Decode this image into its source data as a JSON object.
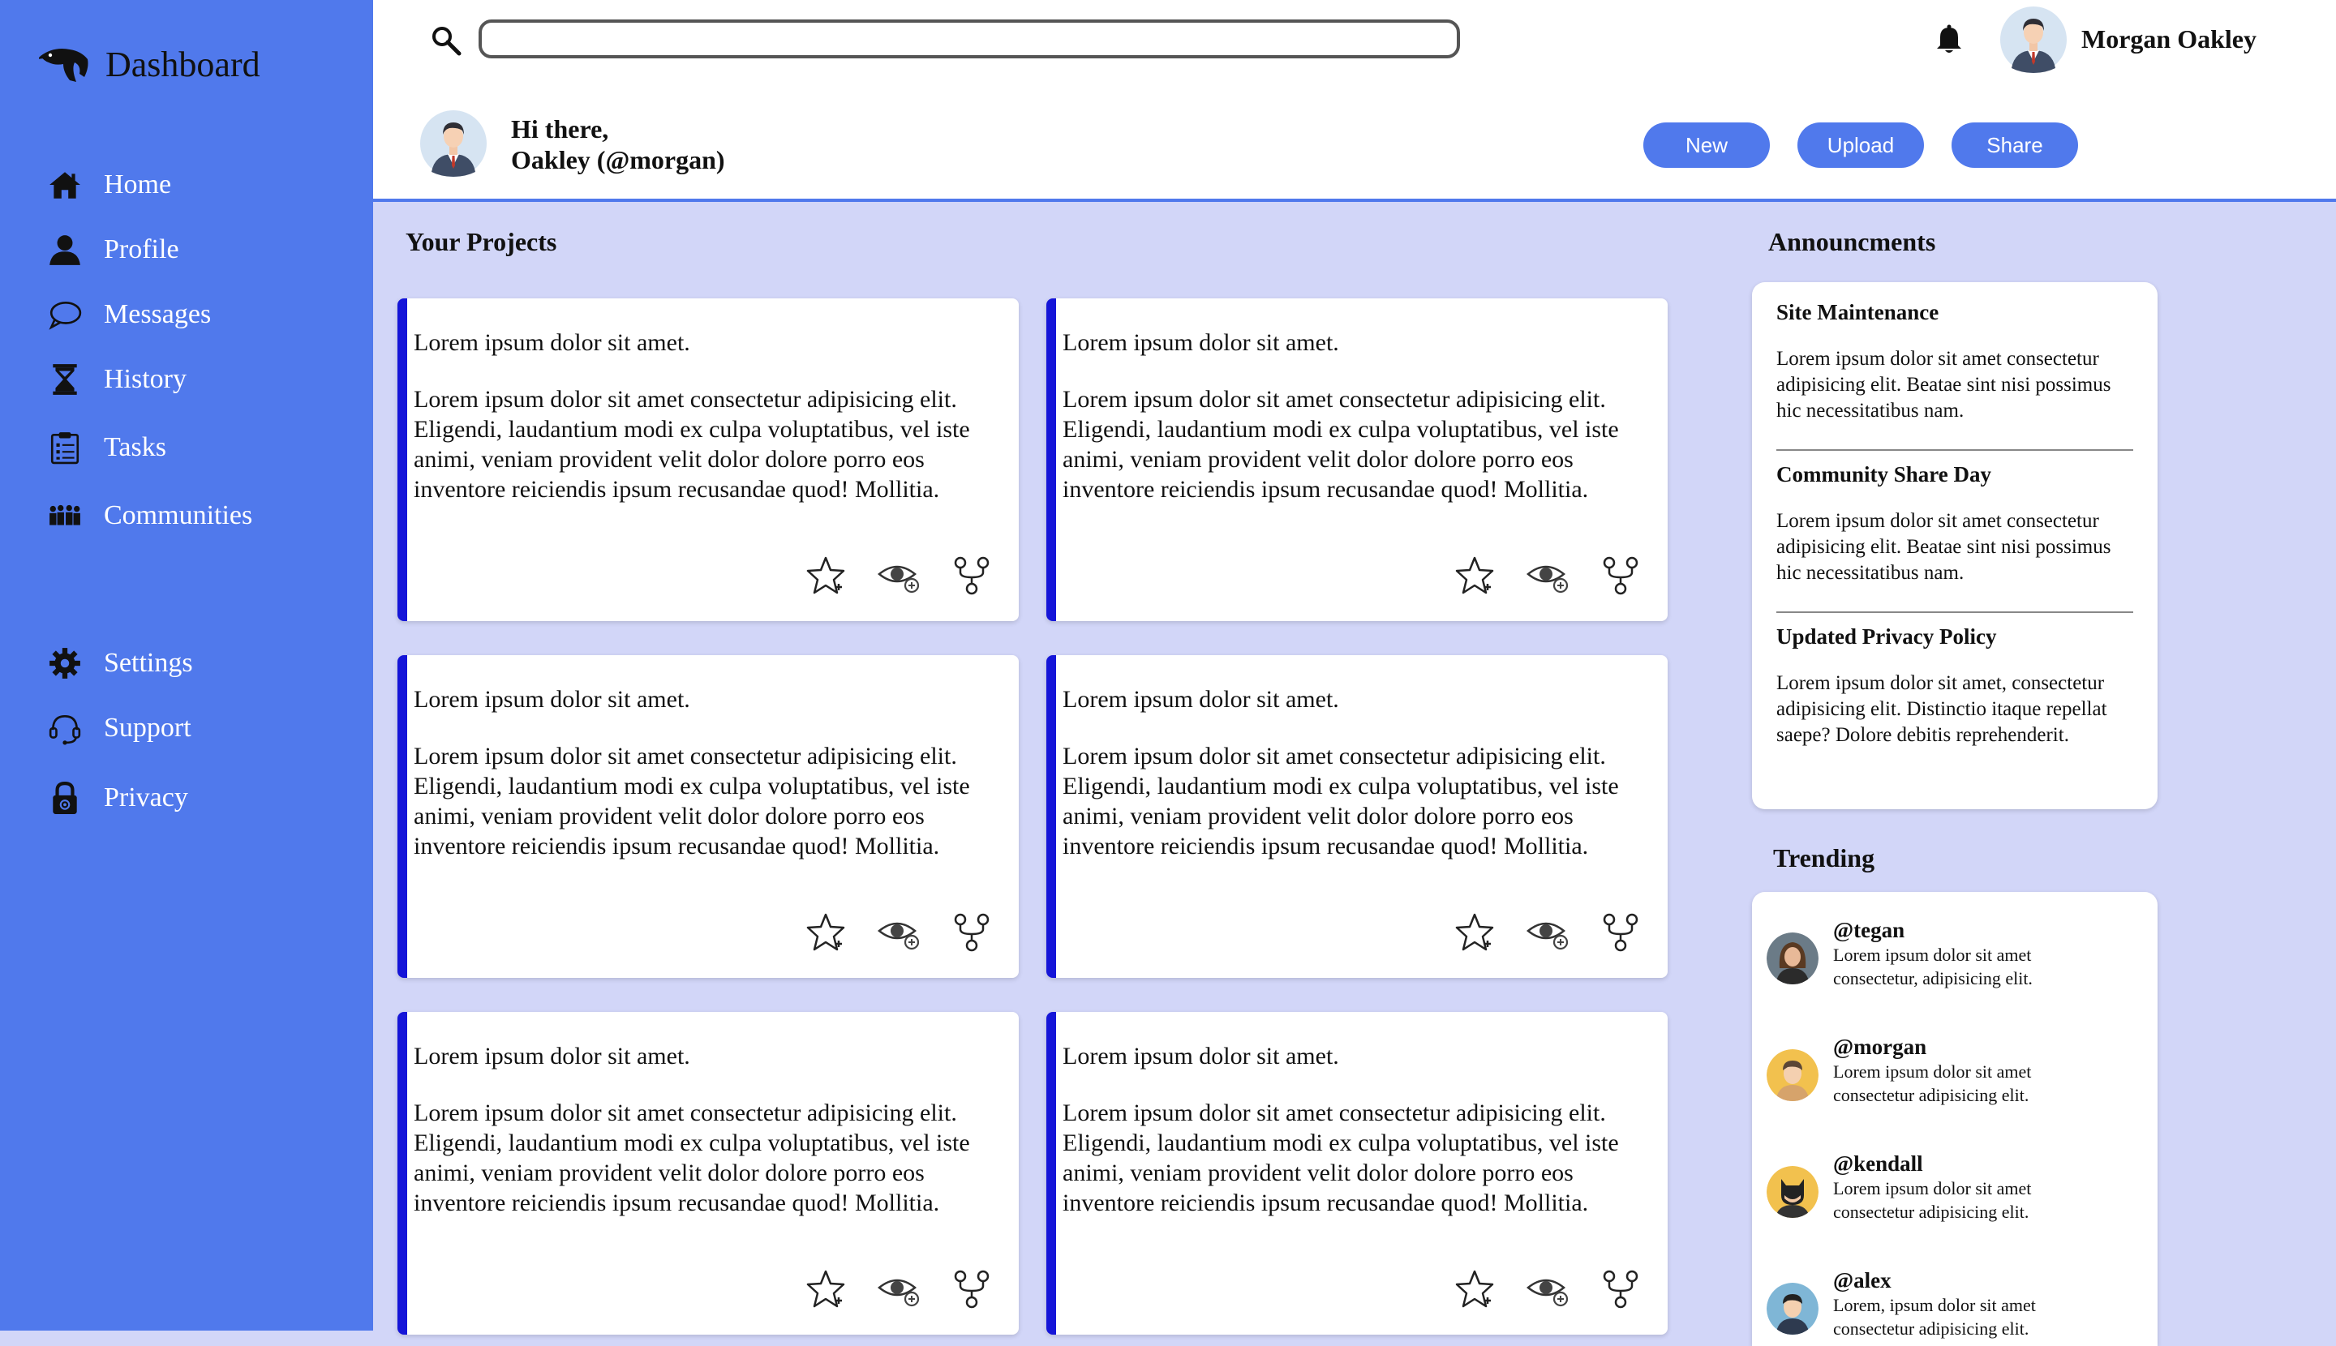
{
  "sidebar": {
    "brand": "Dashboard",
    "items": [
      {
        "label": "Home",
        "icon": "home-icon"
      },
      {
        "label": "Profile",
        "icon": "person-icon"
      },
      {
        "label": "Messages",
        "icon": "chat-bubble-icon"
      },
      {
        "label": "History",
        "icon": "hourglass-icon"
      },
      {
        "label": "Tasks",
        "icon": "clipboard-icon"
      },
      {
        "label": "Communities",
        "icon": "people-group-icon"
      },
      {
        "label": "Settings",
        "icon": "gear-icon"
      },
      {
        "label": "Support",
        "icon": "headset-icon"
      },
      {
        "label": "Privacy",
        "icon": "lock-icon"
      }
    ]
  },
  "topbar": {
    "search_value": "",
    "user_name": "Morgan Oakley"
  },
  "greeting": {
    "line1": "Hi there,",
    "line2": "Oakley (@morgan)"
  },
  "actions": {
    "new": "New",
    "upload": "Upload",
    "share": "Share"
  },
  "projects": {
    "title": "Your Projects",
    "cards": [
      {
        "title": "Lorem ipsum dolor sit amet.",
        "body": "Lorem ipsum dolor sit amet consectetur adipisicing elit. Eligendi, laudantium modi ex culpa voluptatibus, vel iste animi, veniam provident velit dolor dolore porro eos inventore reiciendis ipsum recusandae quod! Mollitia."
      },
      {
        "title": "Lorem ipsum dolor sit amet.",
        "body": "Lorem ipsum dolor sit amet consectetur adipisicing elit. Eligendi, laudantium modi ex culpa voluptatibus, vel iste animi, veniam provident velit dolor dolore porro eos inventore reiciendis ipsum recusandae quod! Mollitia."
      },
      {
        "title": "Lorem ipsum dolor sit amet.",
        "body": "Lorem ipsum dolor sit amet consectetur adipisicing elit. Eligendi, laudantium modi ex culpa voluptatibus, vel iste animi, veniam provident velit dolor dolore porro eos inventore reiciendis ipsum recusandae quod! Mollitia."
      },
      {
        "title": "Lorem ipsum dolor sit amet.",
        "body": "Lorem ipsum dolor sit amet consectetur adipisicing elit. Eligendi, laudantium modi ex culpa voluptatibus, vel iste animi, veniam provident velit dolor dolore porro eos inventore reiciendis ipsum recusandae quod! Mollitia."
      },
      {
        "title": "Lorem ipsum dolor sit amet.",
        "body": "Lorem ipsum dolor sit amet consectetur adipisicing elit. Eligendi, laudantium modi ex culpa voluptatibus, vel iste animi, veniam provident velit dolor dolore porro eos inventore reiciendis ipsum recusandae quod! Mollitia."
      },
      {
        "title": "Lorem ipsum dolor sit amet.",
        "body": "Lorem ipsum dolor sit amet consectetur adipisicing elit. Eligendi, laudantium modi ex culpa voluptatibus, vel iste animi, veniam provident velit dolor dolore porro eos inventore reiciendis ipsum recusandae quod! Mollitia."
      }
    ]
  },
  "announcements": {
    "title": "Announcments",
    "items": [
      {
        "heading": "Site Maintenance",
        "text": "Lorem ipsum dolor sit amet consectetur adipisicing elit. Beatae sint nisi possimus hic necessitatibus nam."
      },
      {
        "heading": "Community Share Day",
        "text": "Lorem ipsum dolor sit amet consectetur adipisicing elit. Beatae sint nisi possimus hic necessitatibus nam."
      },
      {
        "heading": "Updated Privacy Policy",
        "text": "Lorem ipsum dolor sit amet, consectetur adipisicing elit. Distinctio itaque repellat saepe? Dolore debitis reprehenderit."
      }
    ]
  },
  "trending": {
    "title": "Trending",
    "items": [
      {
        "user": "@tegan",
        "text": "Lorem ipsum dolor sit amet consectetur, adipisicing elit."
      },
      {
        "user": "@morgan",
        "text": "Lorem ipsum dolor sit amet consectetur adipisicing elit."
      },
      {
        "user": "@kendall",
        "text": "Lorem ipsum dolor sit amet consectetur adipisicing elit."
      },
      {
        "user": "@alex",
        "text": "Lorem, ipsum dolor sit amet consectetur adipisicing elit."
      }
    ]
  },
  "colors": {
    "sidebar": "#5079ec",
    "accent": "#1515d8",
    "background": "#d2d6f8"
  }
}
